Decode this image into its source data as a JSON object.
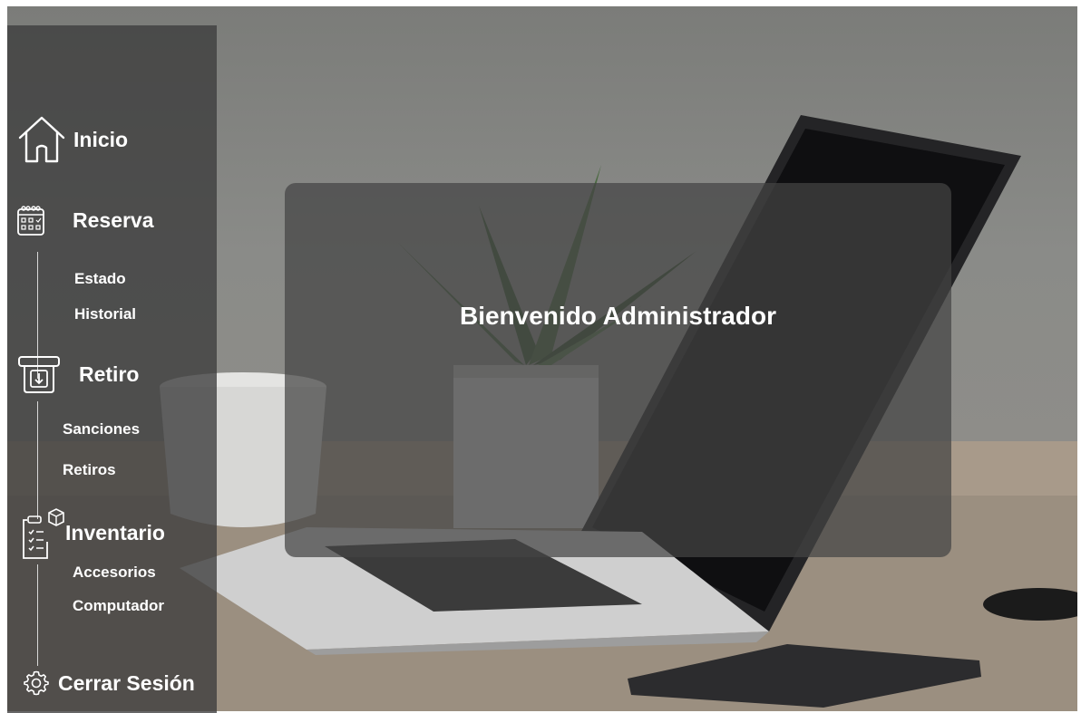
{
  "sidebar": {
    "home": "Inicio",
    "reservation": {
      "label": "Reserva",
      "items": [
        "Estado",
        "Historial"
      ]
    },
    "withdrawal": {
      "label": "Retiro",
      "items": [
        "Sanciones",
        "Retiros"
      ]
    },
    "inventory": {
      "label": "Inventario",
      "items": [
        "Accesorios",
        "Computador"
      ]
    },
    "logout": "Cerrar Sesión"
  },
  "main": {
    "welcome": "Bienvenido Administrador"
  },
  "icons": {
    "home": "home-icon",
    "reservation": "calendar-icon",
    "withdrawal": "tray-download-icon",
    "inventory": "clipboard-box-icon",
    "logout": "gear-icon"
  }
}
